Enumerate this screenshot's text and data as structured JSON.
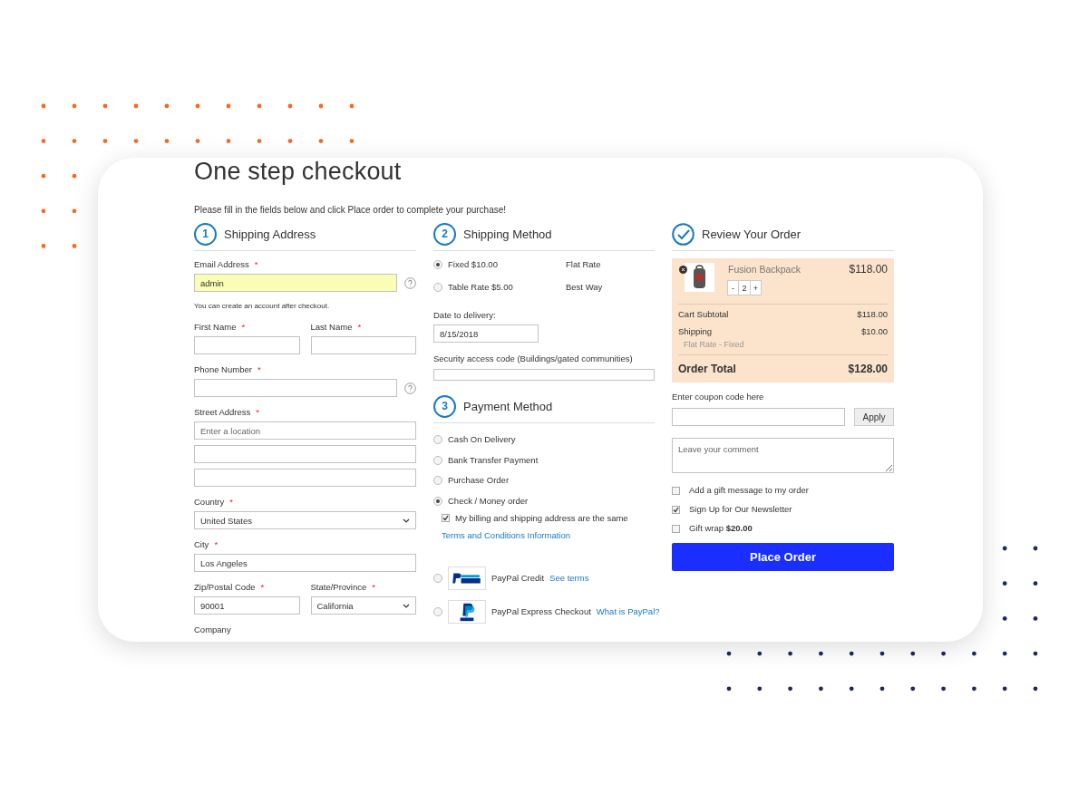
{
  "page": {
    "title": "One step checkout",
    "intro": "Please fill in the fields below and click Place order to complete your purchase!"
  },
  "shipping_address": {
    "marker": {
      "kind": "number",
      "text": "1"
    },
    "heading": "Shipping Address",
    "rows": [
      {
        "fields": [
          {
            "label": "Email Address",
            "required": "*",
            "kind": "text",
            "value": "admin",
            "highlighted": true,
            "help": true,
            "hint": "You can create an account after checkout."
          }
        ]
      },
      {
        "fields": [
          {
            "label": "First Name",
            "required": "*",
            "kind": "text"
          },
          {
            "label": "Last Name",
            "required": "*",
            "kind": "text"
          }
        ]
      },
      {
        "fields": [
          {
            "label": "Phone Number",
            "required": "*",
            "kind": "text",
            "help": true
          }
        ]
      },
      {
        "fields": [
          {
            "label": "Street Address",
            "required": "*",
            "kind": "text",
            "placeholder": "Enter a location"
          }
        ]
      },
      {
        "fields": [
          {
            "kind": "text"
          }
        ]
      },
      {
        "fields": [
          {
            "kind": "text"
          }
        ]
      },
      {
        "fields": [
          {
            "label": "Country",
            "required": "*",
            "kind": "select",
            "value": "United States"
          }
        ]
      },
      {
        "fields": [
          {
            "label": "City",
            "required": "*",
            "kind": "text",
            "value": "Los Angeles"
          }
        ]
      },
      {
        "fields": [
          {
            "label": "Zip/Postal Code",
            "required": "*",
            "kind": "text",
            "value": "90001"
          },
          {
            "label": "State/Province",
            "required": "*",
            "kind": "select",
            "value": "California"
          }
        ]
      },
      {
        "fields": [
          {
            "label": "Company"
          }
        ]
      }
    ]
  },
  "shipping_method": {
    "marker": {
      "kind": "number",
      "text": "2"
    },
    "heading": "Shipping Method",
    "options": [
      {
        "label": "Fixed $10.00",
        "carrier": "Flat Rate",
        "selected": true
      },
      {
        "label": "Table Rate $5.00",
        "carrier": "Best Way",
        "selected": false
      }
    ],
    "date": {
      "label": "Date to delivery:",
      "value": "8/15/2018"
    },
    "security": {
      "label": "Security access code (Buildings/gated communities)"
    }
  },
  "payment_method": {
    "marker": {
      "kind": "number",
      "text": "3"
    },
    "heading": "Payment Method",
    "options": [
      {
        "kind": "plain",
        "label": "Cash On Delivery",
        "selected": false
      },
      {
        "kind": "plain",
        "label": "Bank Transfer Payment",
        "selected": false
      },
      {
        "kind": "plain",
        "label": "Purchase Order",
        "selected": false
      },
      {
        "kind": "plain",
        "label": "Check / Money order",
        "selected": true,
        "billing_same": {
          "label": "My billing and shipping address are the same",
          "checked": true
        },
        "terms_link": "Terms and Conditions Information"
      },
      {
        "kind": "paypal_credit",
        "label": "PayPal Credit",
        "link": "See terms",
        "selected": false
      },
      {
        "kind": "paypal_express",
        "label": "PayPal Express Checkout",
        "link": "What is PayPal?",
        "selected": false
      }
    ]
  },
  "review": {
    "marker": {
      "kind": "check"
    },
    "heading": "Review Your Order",
    "items": [
      {
        "name": "Fusion Backpack",
        "price": "$118.00",
        "qty": "2",
        "minus": "-",
        "plus": "+"
      }
    ],
    "subtotal": {
      "label": "Cart Subtotal",
      "value": "$118.00"
    },
    "shipping": {
      "label": "Shipping",
      "value": "$10.00",
      "method": "Flat Rate - Fixed"
    },
    "total": {
      "label": "Order Total",
      "value": "$128.00"
    },
    "coupon": {
      "label": "Enter coupon code here",
      "button": "Apply"
    },
    "comment": {
      "placeholder": "Leave your comment"
    },
    "options": [
      {
        "label": "Add a gift message to my order",
        "checked": false
      },
      {
        "label": "Sign Up for Our Newsletter",
        "checked": true
      },
      {
        "label": "Gift wrap **$20.00**",
        "checked": false
      }
    ],
    "place_order": "Place Order"
  }
}
